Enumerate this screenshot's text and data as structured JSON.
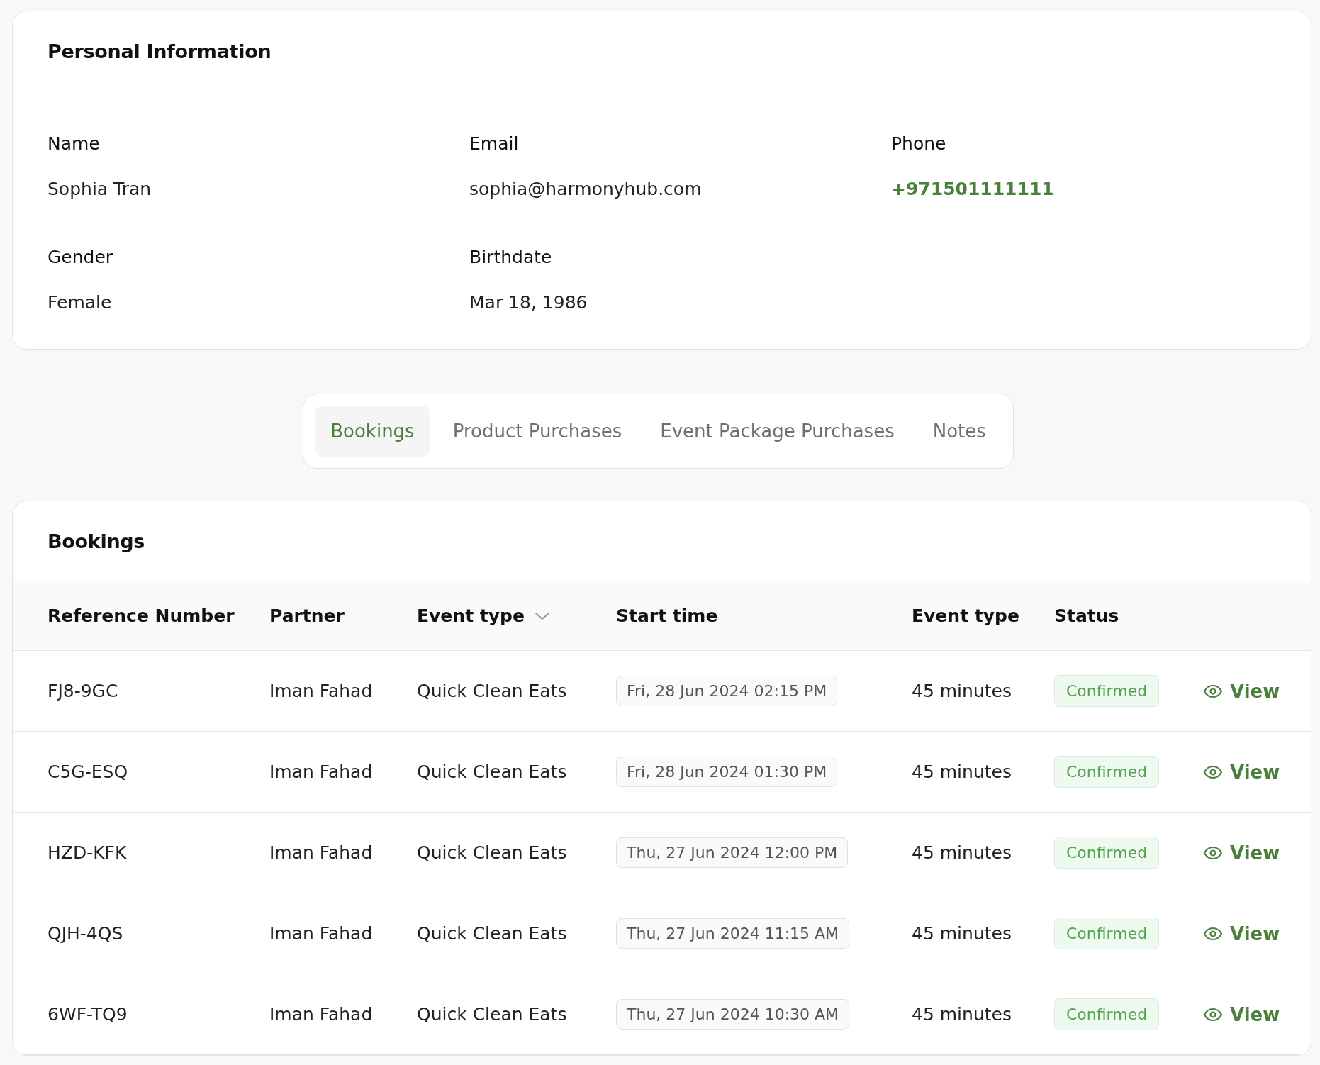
{
  "personal_information": {
    "title": "Personal Information",
    "fields": [
      {
        "label": "Name",
        "value": "Sophia Tran",
        "kind": "text"
      },
      {
        "label": "Email",
        "value": "sophia@harmonyhub.com",
        "kind": "text"
      },
      {
        "label": "Phone",
        "value": "+971501111111",
        "kind": "link"
      },
      {
        "label": "Gender",
        "value": "Female",
        "kind": "text"
      },
      {
        "label": "Birthdate",
        "value": "Mar 18, 1986",
        "kind": "text"
      }
    ]
  },
  "tabs": [
    {
      "label": "Bookings",
      "selected": true
    },
    {
      "label": "Product Purchases",
      "selected": false
    },
    {
      "label": "Event Package Purchases",
      "selected": false
    },
    {
      "label": "Notes",
      "selected": false
    }
  ],
  "bookings": {
    "title": "Bookings",
    "columns": [
      {
        "label": "Reference Number",
        "sortable": false
      },
      {
        "label": "Partner",
        "sortable": false
      },
      {
        "label": "Event type",
        "sortable": true
      },
      {
        "label": "Start time",
        "sortable": false
      },
      {
        "label": "Event type",
        "sortable": false
      },
      {
        "label": "Status",
        "sortable": false
      }
    ],
    "rows": [
      {
        "reference": "FJ8-9GC",
        "partner": "Iman Fahad",
        "event": "Quick Clean Eats",
        "start": "Fri, 28 Jun 2024 02:15 PM",
        "duration": "45 minutes",
        "status": "Confirmed",
        "action": "View"
      },
      {
        "reference": "C5G-ESQ",
        "partner": "Iman Fahad",
        "event": "Quick Clean Eats",
        "start": "Fri, 28 Jun 2024 01:30 PM",
        "duration": "45 minutes",
        "status": "Confirmed",
        "action": "View"
      },
      {
        "reference": "HZD-KFK",
        "partner": "Iman Fahad",
        "event": "Quick Clean Eats",
        "start": "Thu, 27 Jun 2024 12:00 PM",
        "duration": "45 minutes",
        "status": "Confirmed",
        "action": "View"
      },
      {
        "reference": "QJH-4QS",
        "partner": "Iman Fahad",
        "event": "Quick Clean Eats",
        "start": "Thu, 27 Jun 2024 11:15 AM",
        "duration": "45 minutes",
        "status": "Confirmed",
        "action": "View"
      },
      {
        "reference": "6WF-TQ9",
        "partner": "Iman Fahad",
        "event": "Quick Clean Eats",
        "start": "Thu, 27 Jun 2024 10:30 AM",
        "duration": "45 minutes",
        "status": "Confirmed",
        "action": "View"
      }
    ]
  }
}
